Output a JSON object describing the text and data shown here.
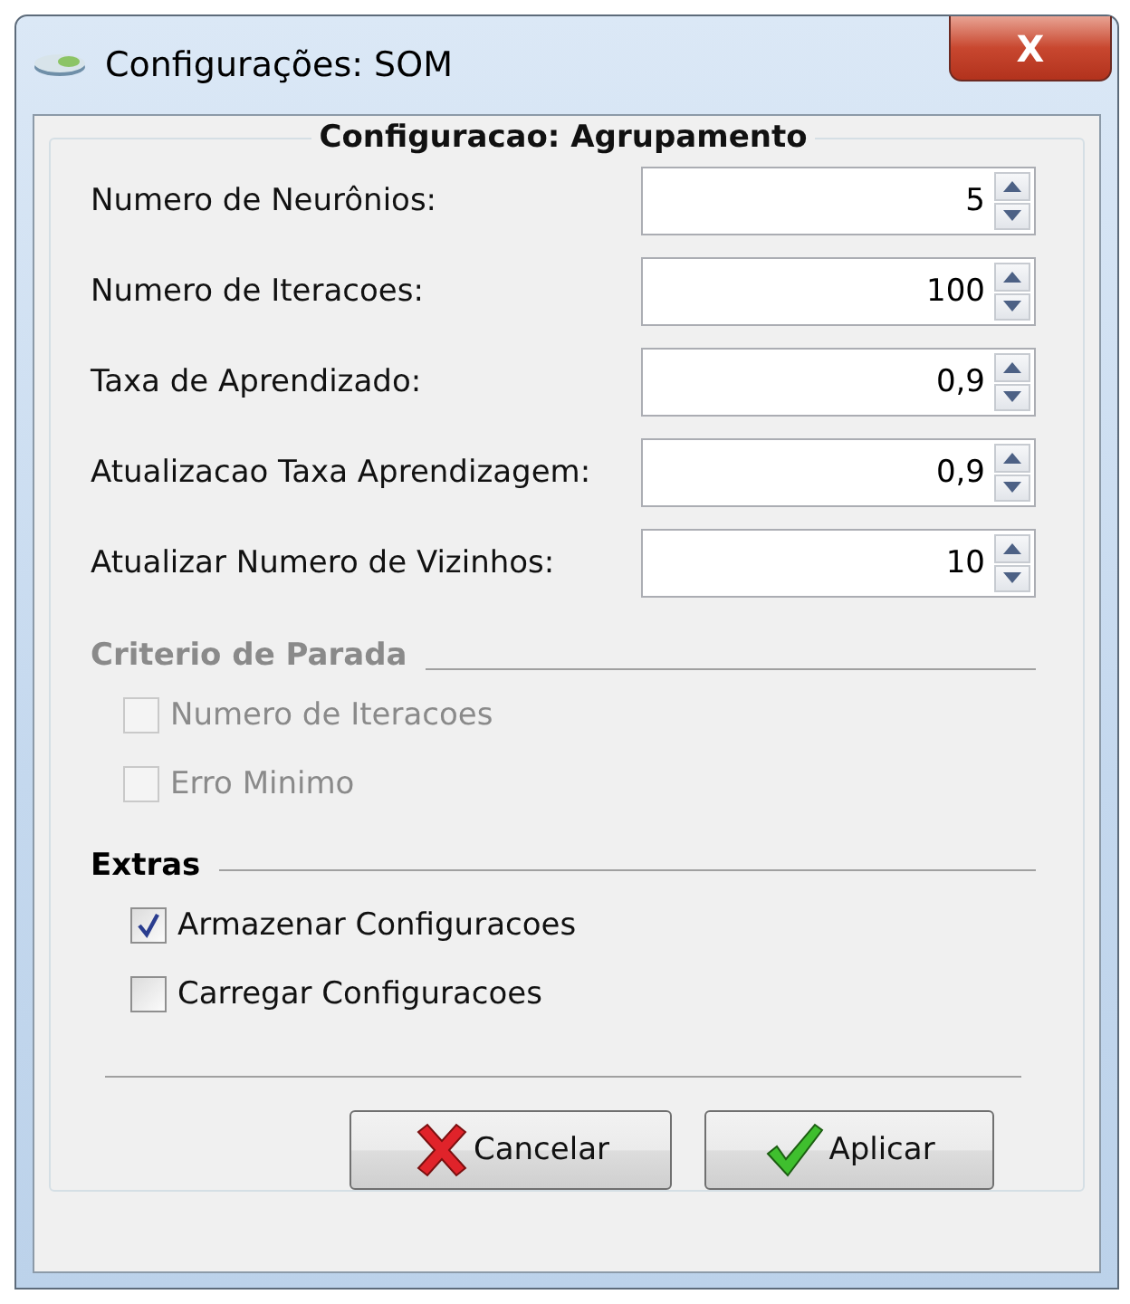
{
  "window": {
    "title": "Configurações: SOM",
    "close": "X"
  },
  "group": {
    "title": "Configuracao: Agrupamento"
  },
  "fields": [
    {
      "label": "Numero de Neurônios:",
      "value": "5"
    },
    {
      "label": "Numero de Iteracoes:",
      "value": "100"
    },
    {
      "label": "Taxa de Aprendizado:",
      "value": "0,9"
    },
    {
      "label": "Atualizacao Taxa Aprendizagem:",
      "value": "0,9"
    },
    {
      "label": "Atualizar Numero de Vizinhos:",
      "value": "10"
    }
  ],
  "sections": [
    {
      "title": "Criterio de Parada",
      "disabled": true,
      "options": [
        {
          "label": "Numero de Iteracoes",
          "checked": false
        },
        {
          "label": "Erro Minimo",
          "checked": false
        }
      ]
    },
    {
      "title": "Extras",
      "disabled": false,
      "options": [
        {
          "label": "Armazenar Configuracoes",
          "checked": true
        },
        {
          "label": "Carregar Configuracoes",
          "checked": false
        }
      ]
    }
  ],
  "buttons": [
    {
      "label": "Cancelar",
      "kind": "cancel"
    },
    {
      "label": "Aplicar",
      "kind": "apply"
    }
  ]
}
